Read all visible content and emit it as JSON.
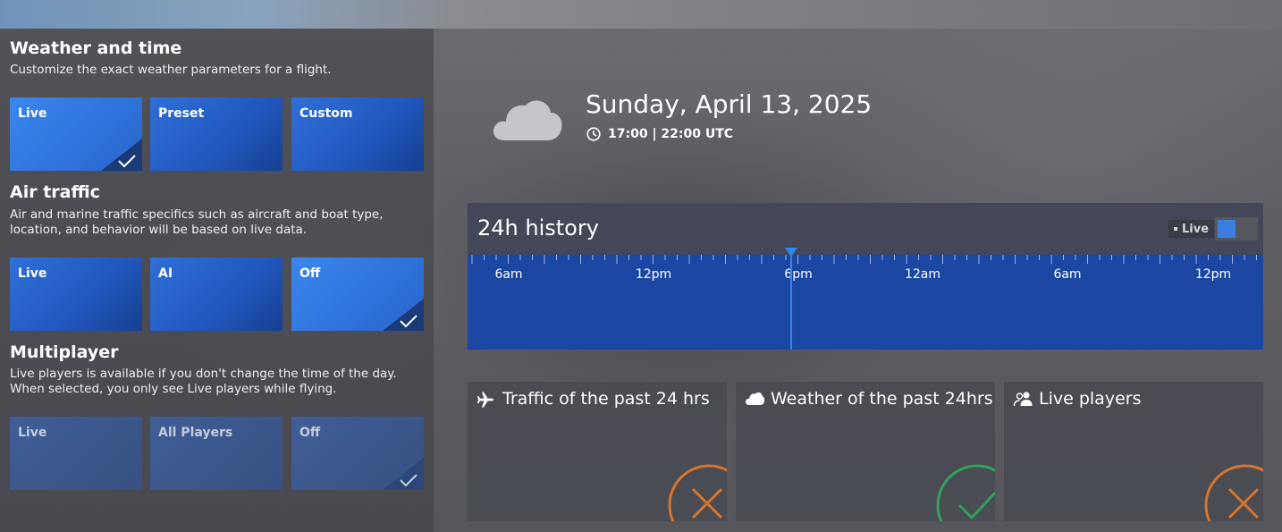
{
  "weather": {
    "title": "Weather and time",
    "description": "Customize the exact weather parameters for a flight.",
    "options": [
      {
        "label": "Live",
        "selected": true
      },
      {
        "label": "Preset",
        "selected": false
      },
      {
        "label": "Custom",
        "selected": false
      }
    ]
  },
  "air_traffic": {
    "title": "Air traffic",
    "description": "Air and marine traffic specifics such as aircraft and boat type, location, and behavior will be based on live data.",
    "options": [
      {
        "label": "Live",
        "selected": false
      },
      {
        "label": "AI",
        "selected": false
      },
      {
        "label": "Off",
        "selected": true
      }
    ]
  },
  "multiplayer": {
    "title": "Multiplayer",
    "description": "Live players is available if you don't change the time of the day. When selected, you only see Live players while flying.",
    "options": [
      {
        "label": "Live",
        "selected": false
      },
      {
        "label": "All Players",
        "selected": false
      },
      {
        "label": "Off",
        "selected": true
      }
    ]
  },
  "conditions": {
    "date": "Sunday, April 13, 2025",
    "time": "17:00 | 22:00 UTC",
    "weather_icon": "cloud-icon"
  },
  "history": {
    "title": "24h history",
    "live_label": "Live",
    "live_toggle_on": true,
    "tick_labels": [
      "6am",
      "12pm",
      "6pm",
      "12am",
      "6am",
      "12pm"
    ],
    "current_marker": "6pm"
  },
  "cards": [
    {
      "title": "Traffic of the past 24 hrs",
      "icon": "airplane-icon",
      "status": "unavailable",
      "status_color": "#d9742a"
    },
    {
      "title": "Weather of the past 24hrs",
      "icon": "cloud-icon",
      "status": "available",
      "status_color": "#2fa35a"
    },
    {
      "title": "Live players",
      "icon": "players-icon",
      "status": "unavailable",
      "status_color": "#d9742a"
    }
  ],
  "colors": {
    "tile_blue": "#2259c1",
    "tile_selected": "#2e72db",
    "timeline_blue": "#1b47a2",
    "cursor_blue": "#2e8bea"
  }
}
